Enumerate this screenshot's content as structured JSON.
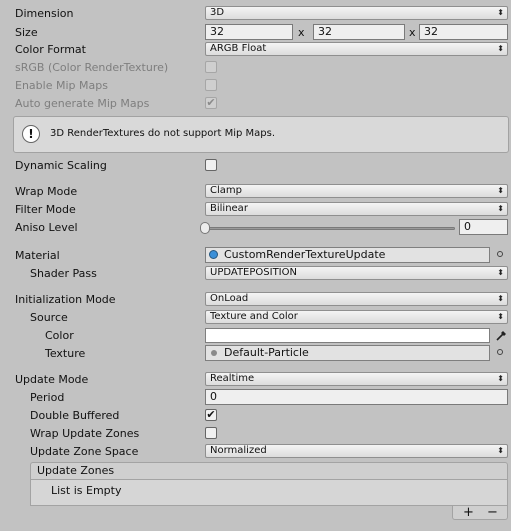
{
  "texture": {
    "dimension": {
      "label": "Dimension",
      "value": "3D"
    },
    "size": {
      "label": "Size",
      "x": "32",
      "y": "32",
      "z": "32",
      "sep": "x"
    },
    "color_format": {
      "label": "Color Format",
      "value": "ARGB Float"
    },
    "srgb": {
      "label": "sRGB (Color RenderTexture)",
      "checked": false
    },
    "enable_mip_maps": {
      "label": "Enable Mip Maps",
      "checked": false
    },
    "auto_generate_mip_maps": {
      "label": "Auto generate Mip Maps",
      "checked": true
    },
    "help_message": "3D RenderTextures do not support Mip Maps.",
    "dynamic_scaling": {
      "label": "Dynamic Scaling",
      "checked": false
    },
    "wrap_mode": {
      "label": "Wrap Mode",
      "value": "Clamp"
    },
    "filter_mode": {
      "label": "Filter Mode",
      "value": "Bilinear"
    },
    "aniso_level": {
      "label": "Aniso Level",
      "value": "0",
      "fraction": 0
    }
  },
  "material_section": {
    "material": {
      "label": "Material",
      "value": "CustomRenderTextureUpdate"
    },
    "shader_pass": {
      "label": "Shader Pass",
      "value": "UPDATEPOSITION"
    }
  },
  "initialization": {
    "mode": {
      "label": "Initialization Mode",
      "value": "OnLoad"
    },
    "source": {
      "label": "Source",
      "value": "Texture and Color"
    },
    "color": {
      "label": "Color",
      "value": "#ffffff"
    },
    "texture": {
      "label": "Texture",
      "value": "Default-Particle"
    }
  },
  "update": {
    "mode": {
      "label": "Update Mode",
      "value": "Realtime"
    },
    "period": {
      "label": "Period",
      "value": "0"
    },
    "double_buffered": {
      "label": "Double Buffered",
      "checked": true
    },
    "wrap_update_zones": {
      "label": "Wrap Update Zones",
      "checked": false
    },
    "zone_space": {
      "label": "Update Zone Space",
      "value": "Normalized"
    },
    "zones": {
      "header": "Update Zones",
      "empty_text": "List is Empty",
      "add": "+",
      "remove": "−"
    }
  },
  "icons": {
    "dropdown_arrow": "⬍",
    "check": "✔",
    "help": "!",
    "eyedropper": "eyedropper-icon"
  },
  "colors": {
    "background": "#c2c2c2",
    "material_icon": "#3a8fd8",
    "texture_icon": "#8a8a8a"
  }
}
